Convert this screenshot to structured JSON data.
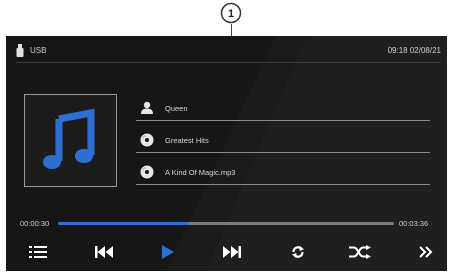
{
  "callout": {
    "number": "1"
  },
  "status_bar": {
    "source_label": "USB",
    "clock": "09:18 02/08/21"
  },
  "track": {
    "artist": "Queen",
    "album": "Greatest Hits",
    "file": "A Kind Of Magic.mp3"
  },
  "playback": {
    "elapsed": "00:00:30",
    "total": "00:03:36",
    "progress_fraction": 0.39
  },
  "controls": [
    "list-icon",
    "previous-icon",
    "play-icon",
    "next-icon",
    "repeat-icon",
    "shuffle-icon",
    "more-icon"
  ],
  "colors": {
    "accent": "#2f6fd3",
    "background": "#161616",
    "text": "#d8d8d8"
  }
}
